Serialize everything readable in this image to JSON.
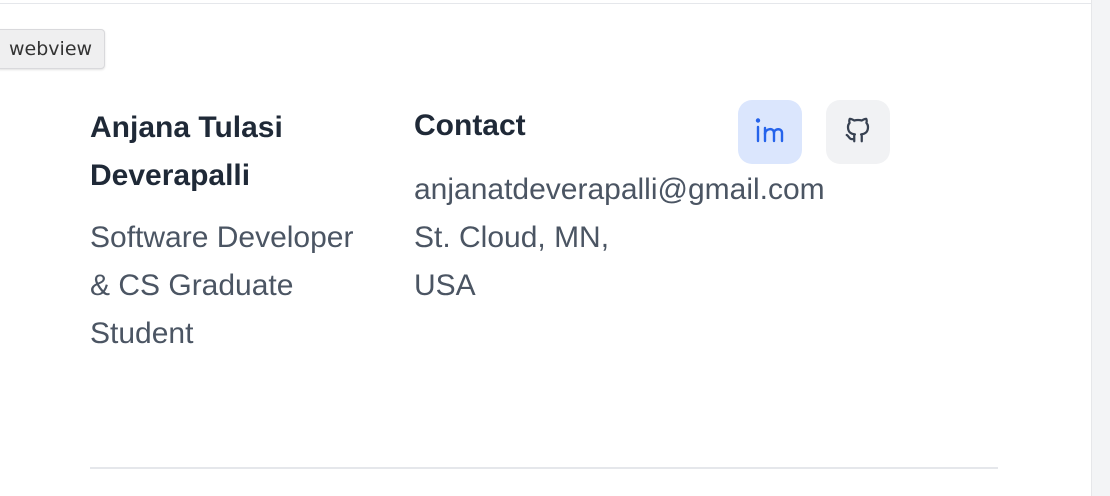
{
  "tooltip": {
    "text": "webview"
  },
  "profile": {
    "name": "Anjana Tulasi Deverapalli",
    "role": "Software Developer & CS Graduate Student"
  },
  "contact": {
    "heading": "Contact",
    "email": "anjanatdeverapalli@gmail.com",
    "address": "St. Cloud, MN, USA"
  },
  "social": [
    {
      "icon": "linkedin-icon",
      "color": "#2563eb",
      "background": "#dbe6fd"
    },
    {
      "icon": "github-icon",
      "color": "#374151",
      "background": "#f1f2f4"
    }
  ]
}
